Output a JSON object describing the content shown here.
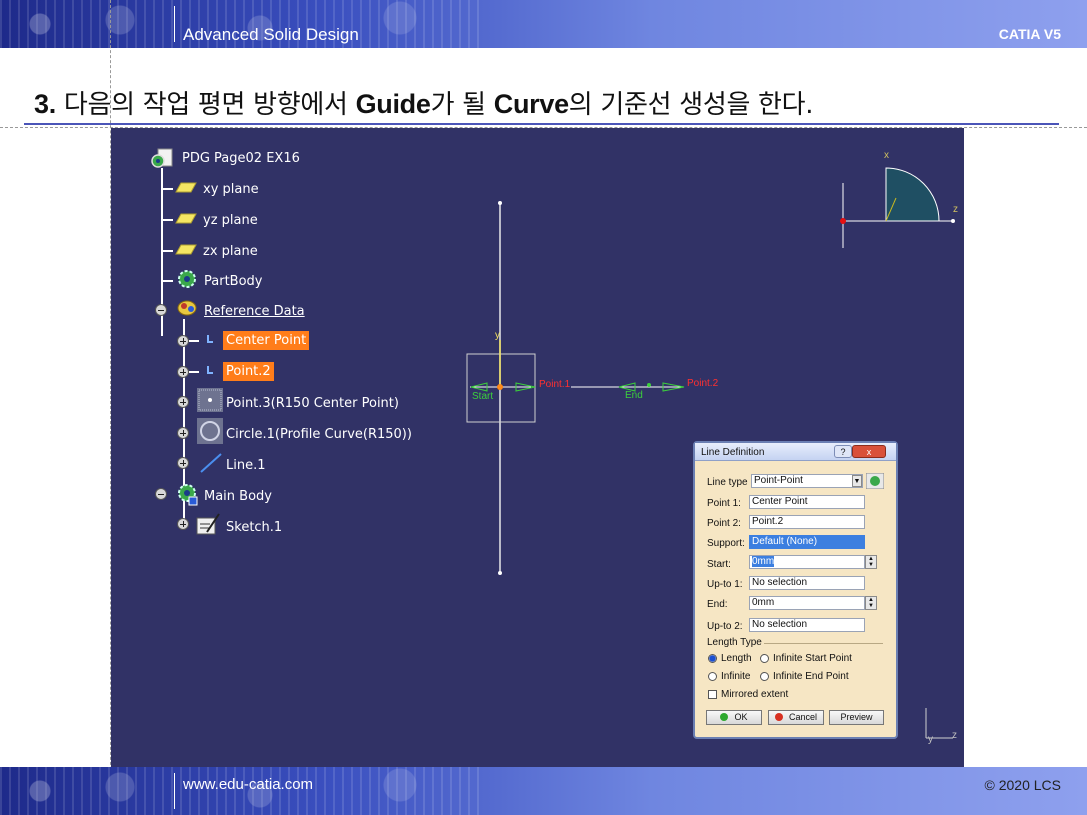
{
  "header": {
    "title": "Advanced Solid Design",
    "right": "CATIA V5"
  },
  "footer": {
    "left": "www.edu-catia.com",
    "right": "© 2020 LCS"
  },
  "heading": {
    "num": "3.",
    "part1": " 다음의 작업 평면 방향에서 ",
    "bold1": "Guide",
    "part2": "가 될 ",
    "bold2": "Curve",
    "part3": "의 기준선 생성을 한다."
  },
  "tree": {
    "root": "PDG Page02 EX16",
    "items": [
      {
        "label": "xy plane",
        "icon": "plane-icon"
      },
      {
        "label": "yz plane",
        "icon": "plane-icon"
      },
      {
        "label": "zx plane",
        "icon": "plane-icon"
      },
      {
        "label": "PartBody",
        "icon": "body-gear-icon"
      },
      {
        "label": "Reference Data",
        "icon": "geometric-set-icon"
      },
      {
        "label": "Center Point",
        "icon": "point-icon"
      },
      {
        "label": "Point.2",
        "icon": "point-icon"
      },
      {
        "label": "Point.3(R150 Center Point)",
        "icon": "point-thumbnail-icon"
      },
      {
        "label": "Circle.1(Profile Curve(R150))",
        "icon": "circle-thumbnail-icon"
      },
      {
        "label": "Line.1",
        "icon": "line-icon"
      },
      {
        "label": "Main Body",
        "icon": "body-gear-icon"
      },
      {
        "label": "Sketch.1",
        "icon": "sketch-icon"
      }
    ]
  },
  "geometry": {
    "labels": {
      "start1": "Start",
      "point1": "Point.1",
      "end": "End",
      "point2": "Point.2"
    },
    "compass_axes": {
      "x": "x",
      "y": "y",
      "z": "z"
    },
    "mini_axes": {
      "y": "y",
      "z": "z"
    }
  },
  "dialog": {
    "title": "Line Definition",
    "help": "?",
    "close": "x",
    "line_type_label": "Line type",
    "line_type_value": "Point-Point",
    "point1_label": "Point 1:",
    "point1_value": "Center Point",
    "point2_label": "Point 2:",
    "point2_value": "Point.2",
    "support_label": "Support:",
    "support_value": "Default (None)",
    "start_label": "Start:",
    "start_value": "0mm",
    "upto1_label": "Up-to 1:",
    "upto1_value": "No selection",
    "end_label": "End:",
    "end_value": "0mm",
    "upto2_label": "Up-to 2:",
    "upto2_value": "No selection",
    "length_type_label": "Length Type",
    "radio_length": "Length",
    "radio_infinite_start": "Infinite Start Point",
    "radio_infinite": "Infinite",
    "radio_infinite_end": "Infinite End Point",
    "mirrored": "Mirrored extent",
    "ok": "OK",
    "cancel": "Cancel",
    "preview": "Preview"
  },
  "colors": {
    "viewport_bg": "#313266",
    "highlight": "#ff7d1a",
    "dialog_bg": "#f6e6c4"
  }
}
